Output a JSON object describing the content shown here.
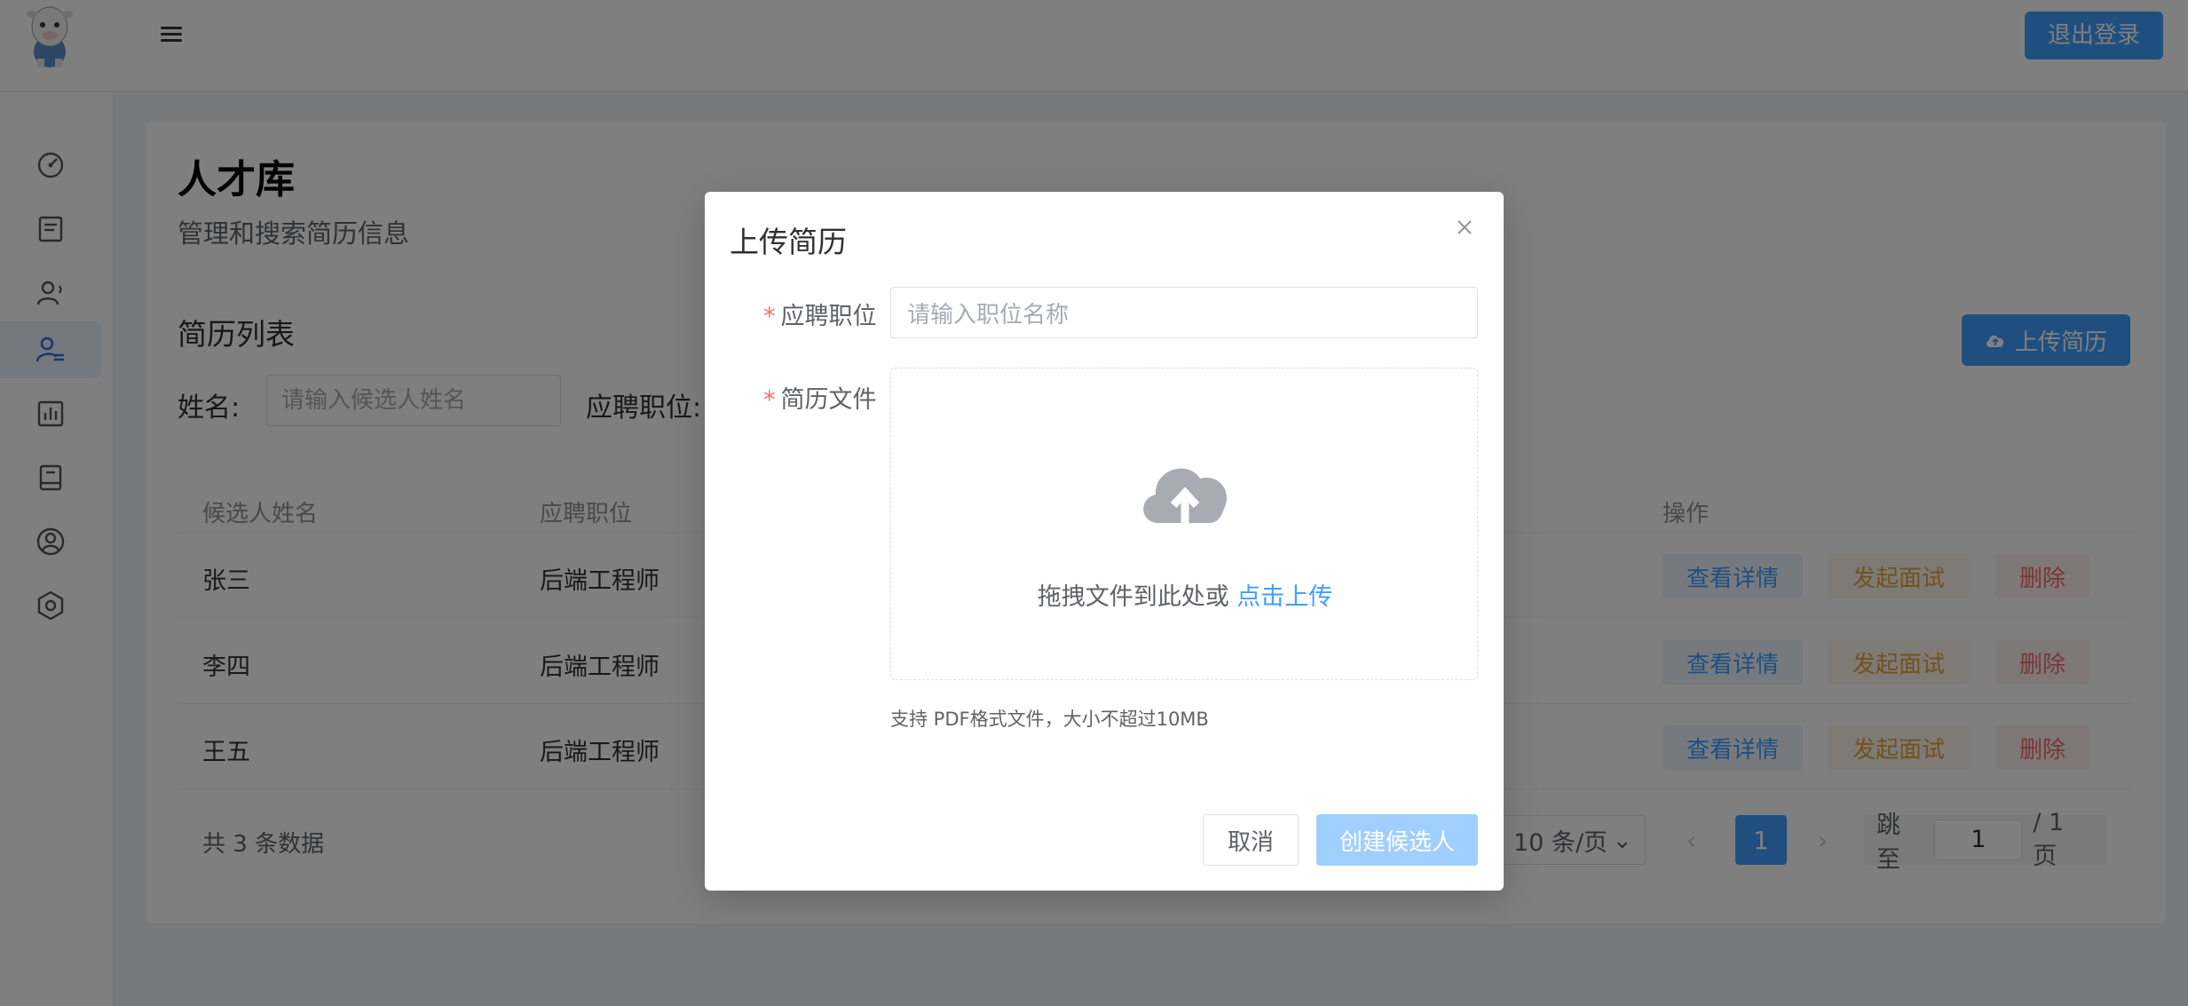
{
  "header": {
    "logout_label": "退出登录"
  },
  "sidebar": {
    "items": [
      {
        "icon": "dashboard-icon"
      },
      {
        "icon": "document-icon"
      },
      {
        "icon": "user-voice-icon"
      },
      {
        "icon": "user-list-icon",
        "active": true
      },
      {
        "icon": "bar-chart-icon"
      },
      {
        "icon": "book-icon"
      },
      {
        "icon": "user-circle-icon"
      },
      {
        "icon": "settings-hexagon-icon"
      }
    ]
  },
  "page": {
    "title": "人才库",
    "subtitle": "管理和搜索简历信息",
    "section_title": "简历列表",
    "upload_button": "上传简历"
  },
  "filters": {
    "name_label": "姓名:",
    "name_placeholder": "请输入候选人姓名",
    "position_label": "应聘职位:"
  },
  "table": {
    "columns": [
      "候选人姓名",
      "应聘职位",
      "操作"
    ],
    "rows": [
      {
        "name": "张三",
        "position": "后端工程师"
      },
      {
        "name": "李四",
        "position": "后端工程师"
      },
      {
        "name": "王五",
        "position": "后端工程师"
      }
    ],
    "actions": {
      "view": "查看详情",
      "interview": "发起面试",
      "delete": "删除"
    }
  },
  "pagination": {
    "total": "共 3 条数据",
    "page_size": "10 条/页",
    "current_page": "1",
    "jump_label": "跳至",
    "jump_value": "1",
    "total_pages": "/ 1 页"
  },
  "dialog": {
    "title": "上传简历",
    "position_label": "应聘职位",
    "position_placeholder": "请输入职位名称",
    "file_label": "简历文件",
    "drop_text": "拖拽文件到此处或",
    "drop_link": "点击上传",
    "tip": "支持 PDF格式文件，大小不超过10MB",
    "cancel_label": "取消",
    "create_label": "创建候选人"
  },
  "colors": {
    "primary": "#409eff",
    "warning": "#e6a23c",
    "danger": "#f56c6c"
  }
}
